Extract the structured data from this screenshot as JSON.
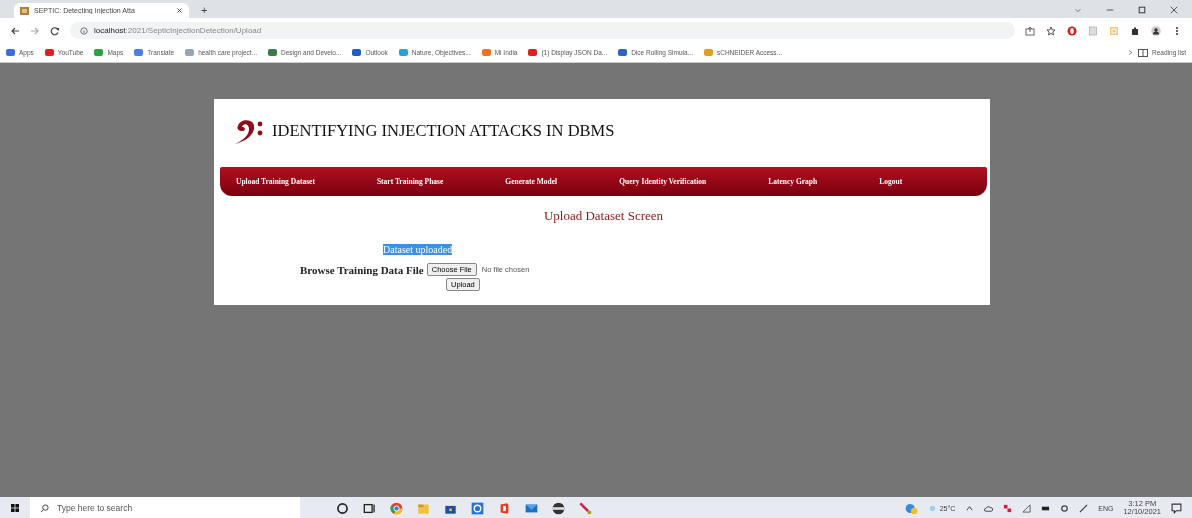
{
  "browser": {
    "tab_title": "SEPTIC: Detecting Injection Atta",
    "new_tab": "+",
    "url_host": "localhost",
    "url_path": ":2021/SepticInjectionDetection/Upload",
    "bookmarks": [
      {
        "label": "Apps",
        "color": "#3b6fd8"
      },
      {
        "label": "YouTube",
        "color": "#e02020"
      },
      {
        "label": "Maps",
        "color": "#2f9e44"
      },
      {
        "label": "Translate",
        "color": "#4a7fe0"
      },
      {
        "label": "health care project...",
        "color": "#9aa3b5"
      },
      {
        "label": "Design and Develo...",
        "color": "#3d7a4a"
      },
      {
        "label": "Outlook",
        "color": "#1f5fbf"
      },
      {
        "label": "Nature, Objectives...",
        "color": "#2a9fd8"
      },
      {
        "label": "Mi India",
        "color": "#f07020"
      },
      {
        "label": "(1) Display JSON Da...",
        "color": "#e02020"
      },
      {
        "label": "Dice Rolling Simula...",
        "color": "#3060c0"
      },
      {
        "label": "sCHNEIDER Access...",
        "color": "#e0a020"
      }
    ],
    "reading_list": "Reading list"
  },
  "page": {
    "title": "IDENTIFYING INJECTION ATTACKS IN DBMS",
    "nav": [
      {
        "label": "Upload Training Dataset"
      },
      {
        "label": "Start Training Phase"
      },
      {
        "label": "Generate Model"
      },
      {
        "label": "Query Identity Verification"
      },
      {
        "label": "Latency Graph"
      },
      {
        "label": "Logout"
      }
    ],
    "heading": "Upload Dataset Screen",
    "message": {
      "text": "Dataset uploaded",
      "selected": true
    },
    "form": {
      "label": "Browse Training Data File",
      "choose_button": "Choose File",
      "file_status": "No file chosen",
      "submit_button": "Upload"
    }
  },
  "taskbar": {
    "search_placeholder": "Type here to search",
    "temperature": "25°C",
    "language": "ENG",
    "time": "3:12 PM",
    "date": "12/10/2021"
  }
}
